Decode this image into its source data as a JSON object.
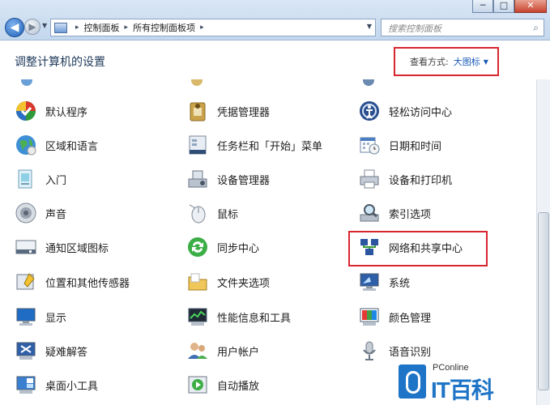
{
  "window": {
    "minimize": "─",
    "maximize": "□",
    "close": "✕"
  },
  "address": {
    "crumbs": [
      "控制面板",
      "所有控制面板项"
    ]
  },
  "search": {
    "placeholder": "搜索控制面板"
  },
  "header": {
    "title": "调整计算机的设置",
    "view_label": "查看方式:",
    "view_value": "大图标"
  },
  "items": [
    {
      "label": "默认程序",
      "icon": "default-programs-icon"
    },
    {
      "label": "凭据管理器",
      "icon": "credential-manager-icon"
    },
    {
      "label": "轻松访问中心",
      "icon": "ease-of-access-icon"
    },
    {
      "label": "区域和语言",
      "icon": "globe-icon"
    },
    {
      "label": "任务栏和「开始」菜单",
      "icon": "taskbar-icon"
    },
    {
      "label": "日期和时间",
      "icon": "calendar-icon"
    },
    {
      "label": "入门",
      "icon": "getting-started-icon"
    },
    {
      "label": "设备管理器",
      "icon": "device-manager-icon"
    },
    {
      "label": "设备和打印机",
      "icon": "printer-icon"
    },
    {
      "label": "声音",
      "icon": "speaker-icon"
    },
    {
      "label": "鼠标",
      "icon": "mouse-icon"
    },
    {
      "label": "索引选项",
      "icon": "index-search-icon"
    },
    {
      "label": "通知区域图标",
      "icon": "notification-area-icon"
    },
    {
      "label": "同步中心",
      "icon": "sync-icon"
    },
    {
      "label": "网络和共享中心",
      "icon": "network-icon"
    },
    {
      "label": "位置和其他传感器",
      "icon": "location-sensor-icon"
    },
    {
      "label": "文件夹选项",
      "icon": "folder-icon"
    },
    {
      "label": "系统",
      "icon": "system-icon"
    },
    {
      "label": "显示",
      "icon": "monitor-icon"
    },
    {
      "label": "性能信息和工具",
      "icon": "performance-icon"
    },
    {
      "label": "颜色管理",
      "icon": "color-management-icon"
    },
    {
      "label": "疑难解答",
      "icon": "troubleshoot-icon"
    },
    {
      "label": "用户帐户",
      "icon": "users-icon"
    },
    {
      "label": "语音识别",
      "icon": "microphone-icon"
    },
    {
      "label": "桌面小工具",
      "icon": "gadgets-icon"
    },
    {
      "label": "自动播放",
      "icon": "autoplay-icon"
    }
  ],
  "watermark": {
    "small": "PConline",
    "big": "IT百科"
  },
  "colors": {
    "highlight": "#d8262f",
    "link": "#1a5bb8"
  }
}
